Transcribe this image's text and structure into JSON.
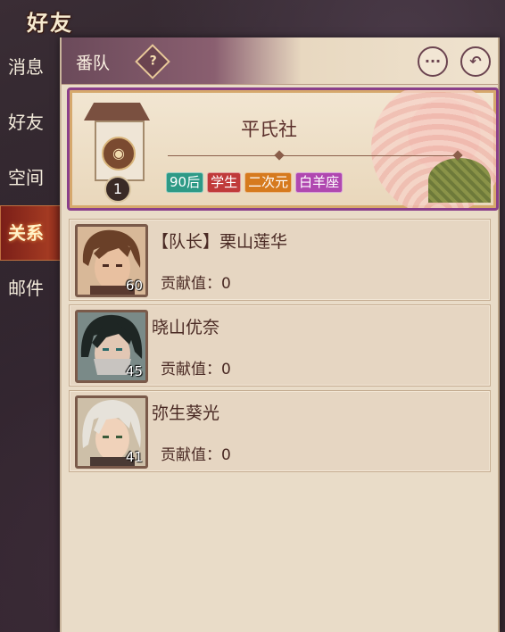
{
  "screen_title": "好友",
  "sidebar": {
    "items": [
      {
        "label": "消息",
        "active": false
      },
      {
        "label": "好友",
        "active": false
      },
      {
        "label": "空间",
        "active": false
      },
      {
        "label": "关系",
        "active": true
      },
      {
        "label": "邮件",
        "active": false
      }
    ]
  },
  "panel": {
    "title": "番队",
    "help_icon": "?",
    "more_icon": "···",
    "back_icon": "↶"
  },
  "team": {
    "name": "平氏社",
    "level": "1",
    "emblem_icon": "tomoe-emblem-icon",
    "tags": [
      {
        "label": "90后",
        "color": "#2e9a86"
      },
      {
        "label": "学生",
        "color": "#c03a3a"
      },
      {
        "label": "二次元",
        "color": "#d67a1e"
      },
      {
        "label": "白羊座",
        "color": "#b048b0"
      }
    ]
  },
  "members": [
    {
      "name": "【队长】栗山莲华",
      "level": "60",
      "contribution": "贡献值：0",
      "hair": "#6a4028",
      "skin": "#e8c0a0"
    },
    {
      "name": "晓山优奈",
      "level": "45",
      "contribution": "贡献值：0",
      "hair": "#1e2624",
      "skin": "#e2c7b4"
    },
    {
      "name": "弥生葵光",
      "level": "41",
      "contribution": "贡献值：0",
      "hair": "#e6e2da",
      "skin": "#f0d2ba"
    }
  ]
}
